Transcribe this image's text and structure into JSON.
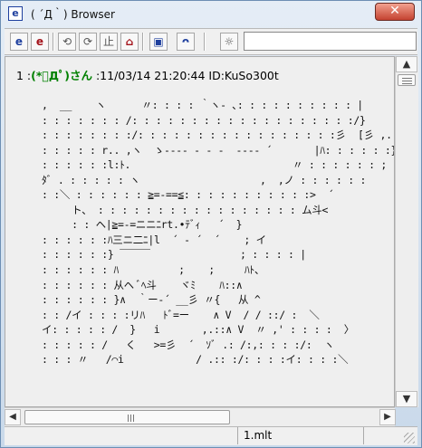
{
  "window": {
    "title": "( ´Д｀) Browser",
    "app_icon": "e",
    "close_symbol": "✕"
  },
  "toolbar": {
    "buttons": [
      {
        "name": "open-browser-icon",
        "symbol": "e"
      },
      {
        "name": "open-red-browser-icon",
        "symbol": "e"
      },
      {
        "name": "back-icon",
        "symbol": "⟲"
      },
      {
        "name": "forward-icon",
        "symbol": "⟳"
      },
      {
        "name": "stop-icon",
        "symbol": "止"
      },
      {
        "name": "home-icon",
        "symbol": "⌂"
      },
      {
        "name": "window-icon",
        "symbol": "▣"
      },
      {
        "name": "face-icon",
        "symbol": "ᴖ"
      },
      {
        "name": "settings-face-icon",
        "symbol": "☼"
      }
    ],
    "address_value": ""
  },
  "post": {
    "number": "1",
    "separator": " :",
    "name": "(*ﾟДﾟ)さん",
    "meta": " :11/03/14 21:20:44 ID:KuSo300t"
  },
  "ascii_art": [
    ",  __    ヽ      〃: : : : ｀ヽ- ､: : : : : : : : : : |",
    ": : : : : : : /: : : : : : : : : : : : : : : : : : :/}",
    ": : : : : : : :/: : : : : : : : : : : : : : : : :彡  [彡 ,. ─ ､",
    ": : : : : r.. ,ヽ  ゝ-‐‐‐ - - -  ‐‐‐‐ ´       |ﾊ: : : : : :}",
    ": : : : : :l:ﾄ.                           〃 : : : : : : ;",
    "ﾀﾞ . : : : : : ヽ                    ,  ,ノ : : : : : :",
    ": :＼ : : : : : : ≧=-==≦: : : : : : : : : : :>  ´",
    "     ト、 : : : : : : : : : : : : : : : : : ム斗<",
    "     : : ヘ|≧=-=ニニﾆrt.•ﾃﾞｨ   ´  }",
    ": : : : : :ﾊ三ニ二ﾆ|l  ´ ‐ ´  ´    ; イ",
    ": : : : : :} ￣￣￣               ; : : : : |",
    ": : : : : : ﾊ          ;    ;     ﾊﾄ、",
    ": : : : : : 从ヘ ﾞﾍ斗    ヾﾐ    ﾊ::∧",
    ": : : : : : }∧  ｀ー‐´ __彡 〃{   从 ^",
    ": : /イ : : : :リﾊ   ﾄﾞ=ー    ∧ V  / / ::/ :  ＼",
    "イ: : : : : /  }   i       ,.::∧ V  〃 ,' : : : :  〉",
    ": : : : : /   く   >=彡  ´  ｿﾞ .: /:,: : : :/:  ヽ",
    ": : : 〃   /⌒i            / .:: :/: : : :イ: : : :＼"
  ],
  "scrollbar": {
    "up_symbol": "▲",
    "down_symbol": "▼",
    "left_symbol": "◀",
    "right_symbol": "▶"
  },
  "status": {
    "left": "",
    "file": "1.mlt"
  }
}
